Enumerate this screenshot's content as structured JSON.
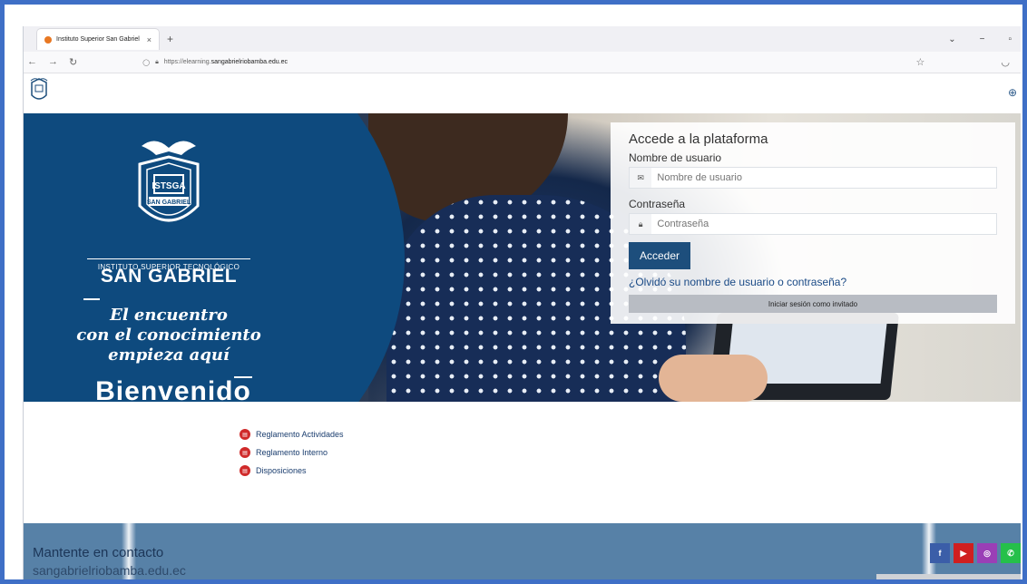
{
  "browser": {
    "tab_title": "Instituto Superior San Gabriel",
    "tab_close": "×",
    "new_tab": "+",
    "url_prefix": "https://elearning.",
    "url_host": "sangabrielriobamba.edu.ec"
  },
  "hero": {
    "institute_small": "INSTITUTO SUPERIOR TECNOLÓGICO",
    "institute_big": "SAN GABRIEL",
    "crest_text_top": "ISTSGA",
    "crest_text_band": "SAN GABRIEL",
    "slogan_line1": "El encuentro",
    "slogan_line2": "con el conocimiento",
    "slogan_line3": "empieza aquí",
    "welcome": "Bienvenido"
  },
  "login": {
    "title": "Accede a la plataforma",
    "username_label": "Nombre de usuario",
    "username_placeholder": "Nombre de usuario",
    "password_label": "Contraseña",
    "password_placeholder": "Contraseña",
    "submit_label": "Acceder",
    "forgot_label": "¿Olvidó su nombre de usuario o contraseña?",
    "guest_label": "Iniciar sesión como invitado"
  },
  "links": [
    {
      "label": "Reglamento Actividades"
    },
    {
      "label": "Reglamento Interno"
    },
    {
      "label": "Disposiciones"
    }
  ],
  "footer": {
    "heading": "Mantente en contacto",
    "email": "sangabrielriobamba.edu.ec"
  },
  "social": {
    "facebook_color": "#3b5ea8",
    "youtube_color": "#d01f1f",
    "instagram_color": "#9a3fb6",
    "whatsapp_color": "#25c04a"
  },
  "colors": {
    "brand_blue": "#0e4a7e",
    "button_blue": "#1d4e7c",
    "footer_blue": "#5781a7"
  }
}
